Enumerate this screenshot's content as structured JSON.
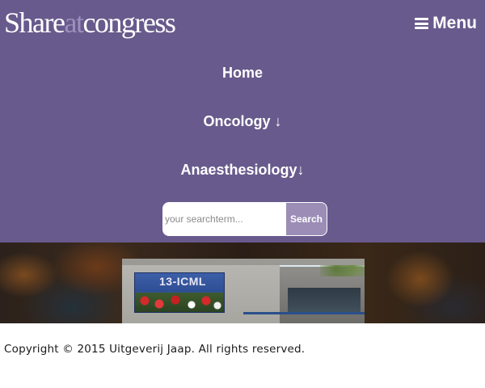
{
  "header": {
    "logo": {
      "part1": "Share",
      "part2": "at",
      "part3": "congress"
    },
    "menu_label": "Menu",
    "menu_icon": "hamburger-icon"
  },
  "nav": {
    "items": [
      {
        "label": "Home"
      },
      {
        "label": "Oncology ↓"
      },
      {
        "label": "Anaesthesiology↓"
      }
    ]
  },
  "search": {
    "placeholder": "your searchterm...",
    "value": "",
    "button_label": "Search"
  },
  "banner": {
    "poster_text": "13-ICML"
  },
  "footer": {
    "copyright": "Copyright © 2015 Uitgeverij Jaap. All rights reserved."
  },
  "colors": {
    "header_bg": "#685a8c",
    "accent": "#9b8db6",
    "logo_at": "#9d90bd"
  }
}
